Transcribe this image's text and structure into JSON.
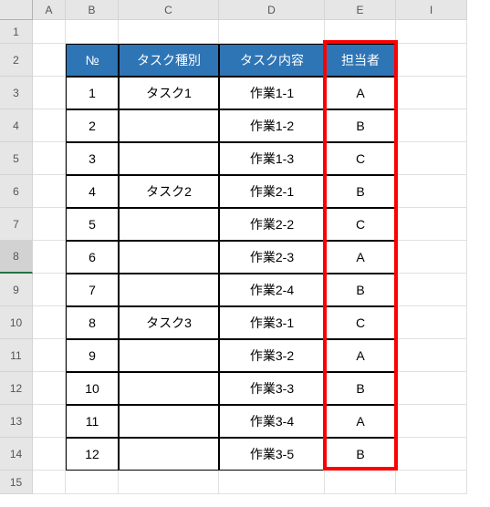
{
  "columns": [
    "A",
    "B",
    "C",
    "D",
    "E",
    "I"
  ],
  "row_headers": [
    "1",
    "2",
    "3",
    "4",
    "5",
    "6",
    "7",
    "8",
    "9",
    "10",
    "11",
    "12",
    "13",
    "14",
    "15"
  ],
  "selected_row_header": "8",
  "table": {
    "headers": {
      "no": "№",
      "type": "タスク種別",
      "content": "タスク内容",
      "owner": "担当者"
    },
    "rows": [
      {
        "no": "1",
        "type": "タスク1",
        "content": "作業1-1",
        "owner": "A"
      },
      {
        "no": "2",
        "type": "",
        "content": "作業1-2",
        "owner": "B"
      },
      {
        "no": "3",
        "type": "",
        "content": "作業1-3",
        "owner": "C"
      },
      {
        "no": "4",
        "type": "タスク2",
        "content": "作業2-1",
        "owner": "B"
      },
      {
        "no": "5",
        "type": "",
        "content": "作業2-2",
        "owner": "C"
      },
      {
        "no": "6",
        "type": "",
        "content": "作業2-3",
        "owner": "A"
      },
      {
        "no": "7",
        "type": "",
        "content": "作業2-4",
        "owner": "B"
      },
      {
        "no": "8",
        "type": "タスク3",
        "content": "作業3-1",
        "owner": "C"
      },
      {
        "no": "9",
        "type": "",
        "content": "作業3-2",
        "owner": "A"
      },
      {
        "no": "10",
        "type": "",
        "content": "作業3-3",
        "owner": "B"
      },
      {
        "no": "11",
        "type": "",
        "content": "作業3-4",
        "owner": "A"
      },
      {
        "no": "12",
        "type": "",
        "content": "作業3-5",
        "owner": "B"
      }
    ]
  }
}
